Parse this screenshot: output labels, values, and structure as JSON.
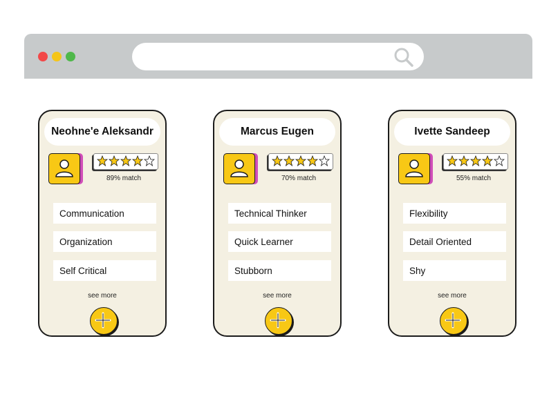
{
  "browser": {
    "icons": {
      "dots": [
        "close-dot",
        "minimize-dot",
        "maximize-dot"
      ],
      "search": "search-icon"
    }
  },
  "colors": {
    "card_bg": "#f4f0e2",
    "accent_yellow": "#f8c815",
    "accent_pink": "#d14fb8",
    "bar_gray": "#c7cacb"
  },
  "cards": [
    {
      "name": "Neohne'e Aleksandr",
      "rating": 4,
      "rating_max": 5,
      "match": "89% match",
      "traits": [
        "Communication",
        "Organization",
        "Self Critical"
      ],
      "see_more": "see more"
    },
    {
      "name": "Marcus Eugen",
      "rating": 4,
      "rating_max": 5,
      "match": "70% match",
      "traits": [
        "Technical Thinker",
        "Quick Learner",
        "Stubborn"
      ],
      "see_more": "see more"
    },
    {
      "name": "Ivette Sandeep",
      "rating": 4,
      "rating_max": 5,
      "match": "55% match",
      "traits": [
        "Flexibility",
        "Detail Oriented",
        "Shy"
      ],
      "see_more": "see more"
    }
  ]
}
